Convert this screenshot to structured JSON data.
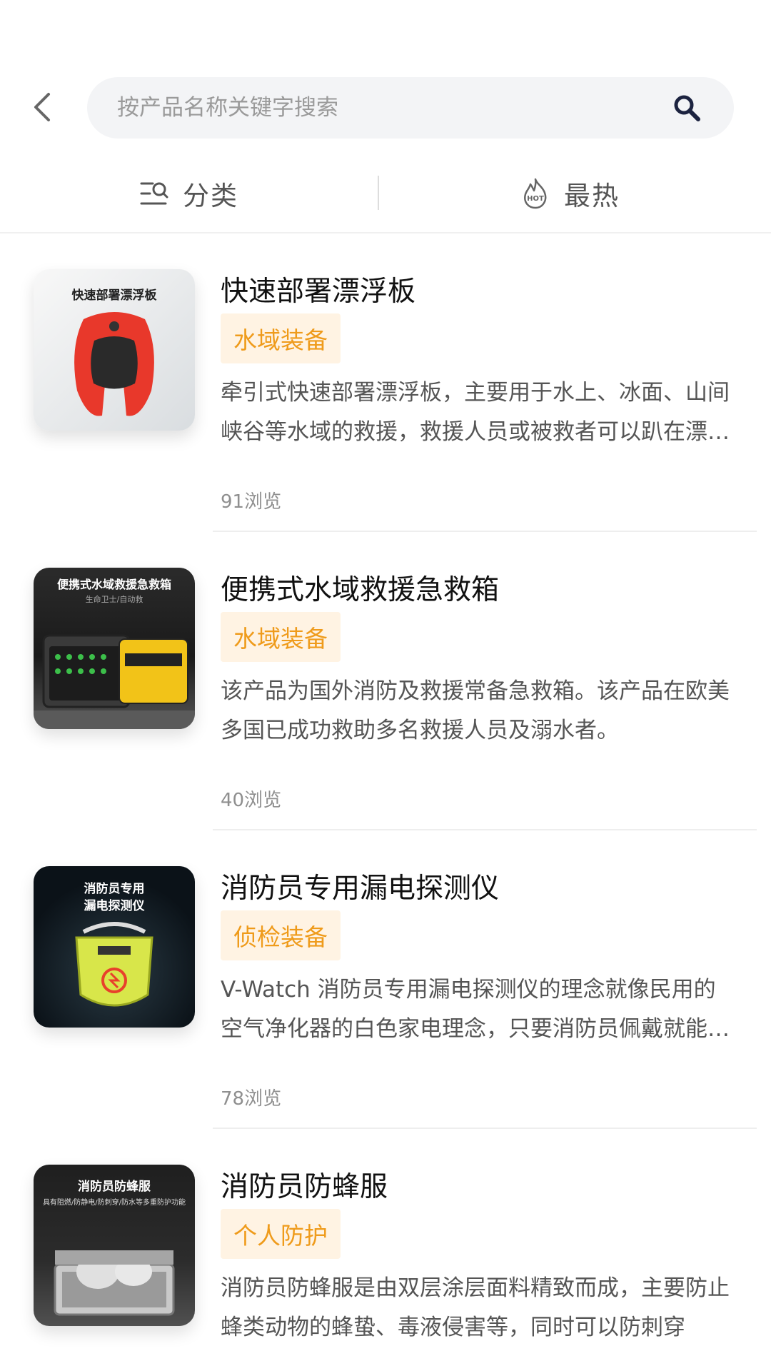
{
  "search": {
    "placeholder": "按产品名称关键字搜索"
  },
  "tabs": {
    "category": "分类",
    "hot": "最热"
  },
  "products": [
    {
      "title": "快速部署漂浮板",
      "tag": "水域装备",
      "description": "牵引式快速部署漂浮板，主要用于水上、冰面、山间峡谷等水域的救援，救援人员或被救者可以趴在漂浮板上",
      "views": "91浏览",
      "thumb_label": "快速部署漂浮板"
    },
    {
      "title": "便携式水域救援急救箱",
      "tag": "水域装备",
      "description": "该产品为国外消防及救援常备急救箱。该产品在欧美多国已成功救助多名救援人员及溺水者。",
      "views": "40浏览",
      "thumb_label": "便携式水域救援急救箱",
      "thumb_sub": "生命卫士/自动救"
    },
    {
      "title": "消防员专用漏电探测仪",
      "tag": "侦检装备",
      "description": "V-Watch 消防员专用漏电探测仪的理念就像民用的空气净化器的白色家电理念，只要消防员佩戴就能时刻探测",
      "views": "78浏览",
      "thumb_label_line1": "消防员专用",
      "thumb_label_line2": "漏电探测仪"
    },
    {
      "title": "消防员防蜂服",
      "tag": "个人防护",
      "description": "消防员防蜂服是由双层涂层面料精致而成，主要防止蜂类动物的蜂蛰、毒液侵害等，同时可以防刺穿",
      "views": "",
      "thumb_label": "消防员防蜂服",
      "thumb_sub": "具有阻燃/防静电/防刺穿/防水等多重防护功能"
    }
  ],
  "colors": {
    "tag_bg": "#fff3e3",
    "tag_text": "#ef9b1b",
    "search_bg": "#f3f4f6"
  }
}
